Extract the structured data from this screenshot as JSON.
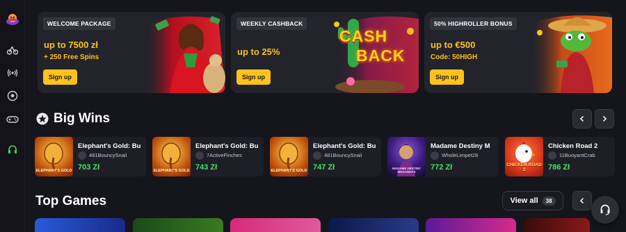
{
  "promos": [
    {
      "tag": "WELCOME PACKAGE",
      "title": "up to 7500 zł",
      "subtitle": "+ 250 Free Spins",
      "button": "Sign up"
    },
    {
      "tag": "WEEKLY CASHBACK",
      "title": "up to 25%",
      "subtitle": "",
      "button": "Sign up",
      "art_text_1": "CASH",
      "art_text_2": "BACK"
    },
    {
      "tag": "50% HIGHROLLER BONUS",
      "title": "up to €500",
      "subtitle": "Code: 50HIGH",
      "button": "Sign up"
    }
  ],
  "big_wins": {
    "title": "Big Wins",
    "items": [
      {
        "game": "Elephant's Gold: Bu",
        "user": "481BouncySnail",
        "amount": "703 Zł"
      },
      {
        "game": "Elephant's Gold: Bu",
        "user": "7ActiveFinches",
        "amount": "743 Zł"
      },
      {
        "game": "Elephant's Gold: Bu",
        "user": "481BouncySnail",
        "amount": "747 Zł"
      },
      {
        "game": "Madame Destiny M",
        "user": "WholeLimpet28",
        "amount": "772 Zł"
      },
      {
        "game": "Chicken Road 2",
        "user": "11BuoyantCrab",
        "amount": "786 Zł"
      }
    ],
    "thumb_text": [
      "ELEPHANT'S GOLD",
      "ELEPHANT'S GOLD",
      "ELEPHANT'S GOLD",
      "MADAME DESTINY MEGAWAYS",
      "CHICKEN ROAD 2"
    ]
  },
  "top_games": {
    "title": "Top Games",
    "view_all": "View all",
    "count": "38"
  },
  "colors": {
    "accent": "#ffc21d",
    "win_green": "#48e06a",
    "bg": "#15151c",
    "card": "#1e1e26"
  }
}
